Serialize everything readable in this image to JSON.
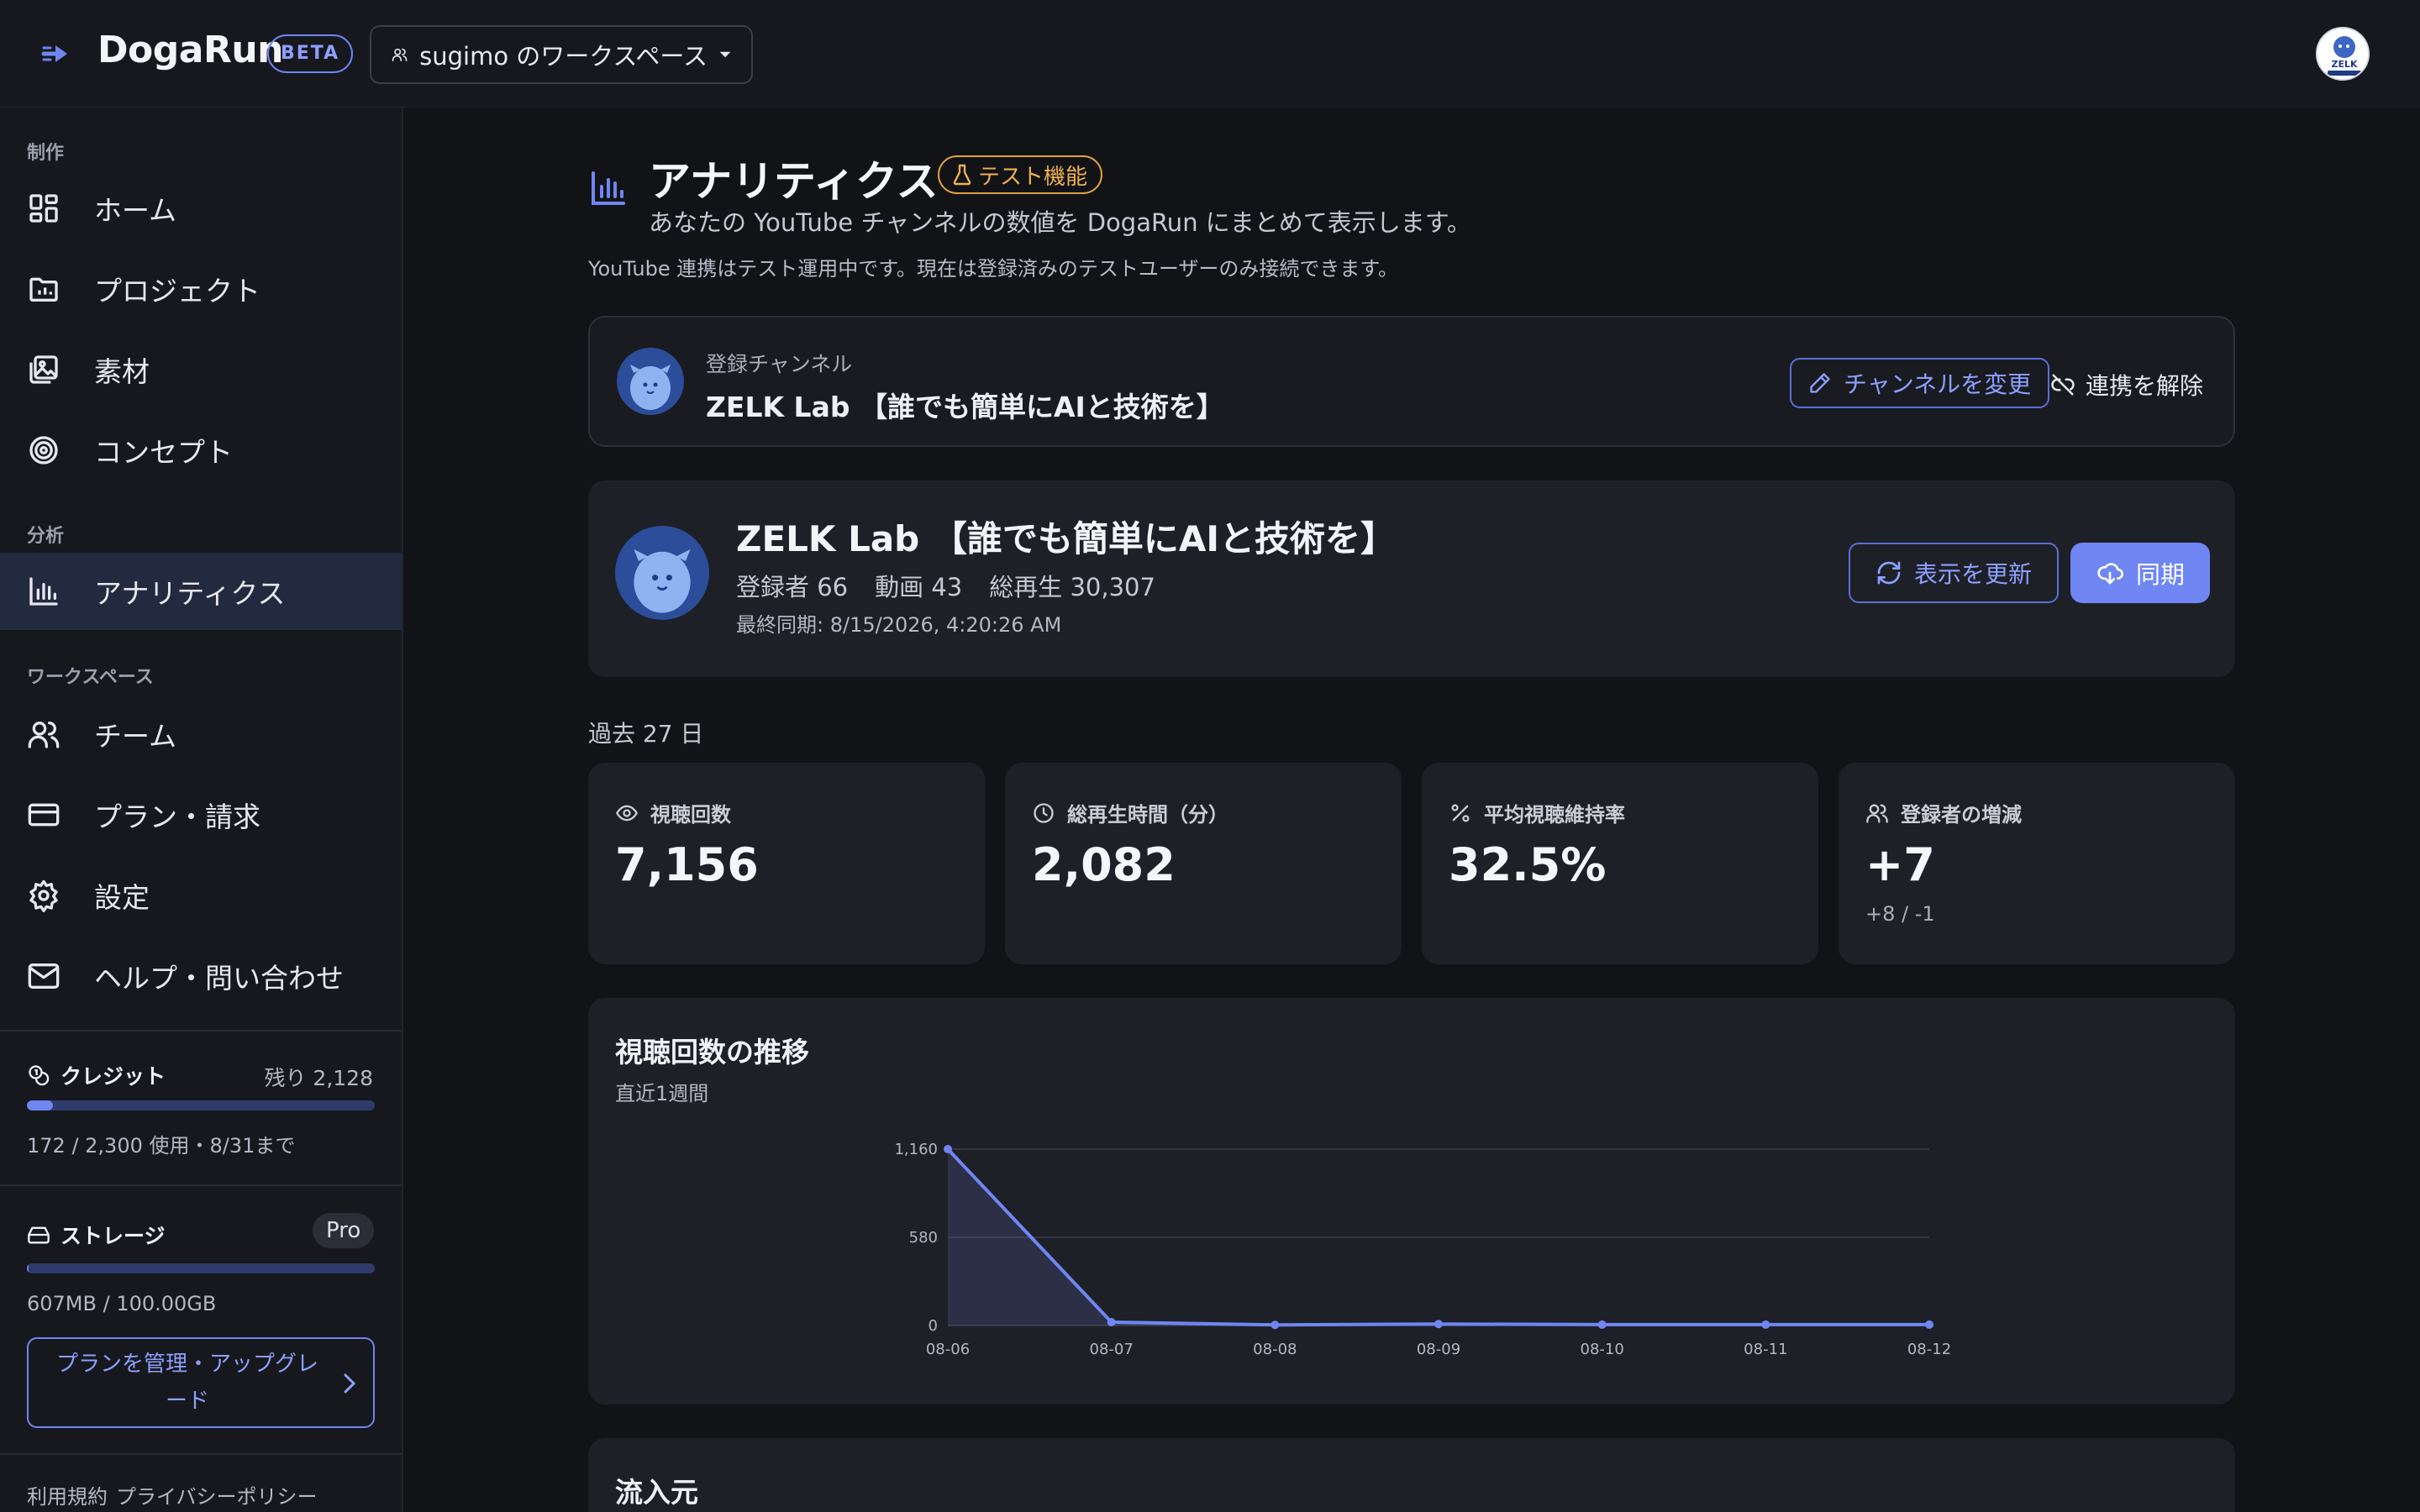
{
  "app": {
    "name": "DogaRun",
    "badge": "BETA"
  },
  "workspace": {
    "label": "sugimo のワークスペース"
  },
  "user": {
    "avatar_text": "ZELK"
  },
  "sidebar": {
    "sections": {
      "create": "制作",
      "analysis": "分析",
      "workspace": "ワークスペース"
    },
    "items": {
      "home": "ホーム",
      "projects": "プロジェクト",
      "assets": "素材",
      "concept": "コンセプト",
      "analytics": "アナリティクス",
      "team": "チーム",
      "billing": "プラン・請求",
      "settings": "設定",
      "help": "ヘルプ・問い合わせ"
    },
    "credit": {
      "title": "クレジット",
      "remaining": "残り 2,128",
      "usage": "172 / 2,300 使用・8/31まで",
      "used_fraction": 0.075
    },
    "storage": {
      "title": "ストレージ",
      "plan": "Pro",
      "usage": "607MB / 100.00GB",
      "used_fraction": 0.006
    },
    "upgrade_label": "プランを管理・アップグレード",
    "legal": {
      "terms": "利用規約",
      "privacy": "プライバシーポリシー"
    }
  },
  "page": {
    "title": "アナリティクス",
    "badge": "テスト機能",
    "subtitle": "あなたの YouTube チャンネルの数値を DogaRun にまとめて表示します。",
    "note": "YouTube 連携はテスト運用中です。現在は登録済みのテストユーザーのみ接続できます。"
  },
  "channel": {
    "label": "登録チャンネル",
    "name": "ZELK Lab 【誰でも簡単にAIと技術を】",
    "change_label": "チャンネルを変更",
    "disconnect_label": "連携を解除"
  },
  "summary": {
    "name": "ZELK Lab 【誰でも簡単にAIと技術を】",
    "subscribers": "登録者 66",
    "videos": "動画 43",
    "total_views": "総再生 30,307",
    "last_sync": "最終同期: 8/15/2026, 4:20:26 AM",
    "refresh_label": "表示を更新",
    "sync_label": "同期"
  },
  "period": "過去 27 日",
  "kpis": [
    {
      "label": "視聴回数",
      "value": "7,156",
      "sub": "",
      "icon": "eye-icon"
    },
    {
      "label": "総再生時間（分）",
      "value": "2,082",
      "sub": "",
      "icon": "clock-icon"
    },
    {
      "label": "平均視聴維持率",
      "value": "32.5%",
      "sub": "",
      "icon": "percent-icon"
    },
    {
      "label": "登録者の増減",
      "value": "+7",
      "sub": "+8 / -1",
      "icon": "users-icon"
    }
  ],
  "views_chart": {
    "title": "視聴回数の推移",
    "subtitle": "直近1週間"
  },
  "chart_data": {
    "type": "area",
    "title": "視聴回数の推移",
    "subtitle": "直近1週間",
    "categories": [
      "08-06",
      "08-07",
      "08-08",
      "08-09",
      "08-10",
      "08-11",
      "08-12"
    ],
    "values": [
      1160,
      22,
      4,
      10,
      6,
      6,
      6
    ],
    "ylim": [
      0,
      1160
    ],
    "yticks": [
      0,
      580,
      1160
    ],
    "ytick_labels": [
      "0",
      "580",
      "1,160"
    ],
    "grid": true,
    "color": "#6f86f3"
  },
  "sources": {
    "title": "流入元"
  },
  "colors": {
    "accent": "#6f86f3",
    "warning": "#e3a13d",
    "background": "#111317",
    "card": "#1e2027"
  }
}
